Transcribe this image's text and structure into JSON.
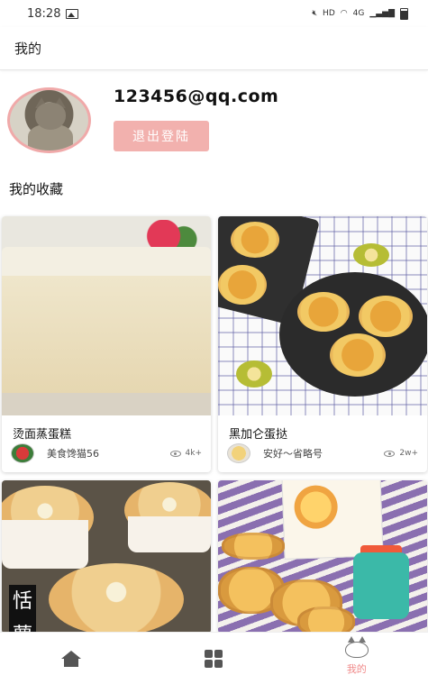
{
  "status_bar": {
    "time": "18:28",
    "network": "4G",
    "hd": "HD",
    "icons": [
      "image-icon",
      "mute-icon",
      "wifi-icon",
      "signal-icon",
      "battery-icon"
    ]
  },
  "app_bar": {
    "title": "我的"
  },
  "profile": {
    "email": "123456@qq.com",
    "logout_label": "退出登陆",
    "accent_color": "#f2b1ae"
  },
  "favorites": {
    "title": "我的收藏",
    "items": [
      {
        "title": "烫面蒸蛋糕",
        "author": "美食馋猫56",
        "views": "4k+"
      },
      {
        "title": "黑加仑蛋挞",
        "author": "安好～省略号",
        "views": "2w+"
      },
      {
        "title": "",
        "author": "",
        "views": ""
      },
      {
        "title": "",
        "author": "",
        "views": ""
      }
    ],
    "muffin_calligraphy": "恬蘿"
  },
  "tab_bar": {
    "tabs": [
      {
        "icon": "home-icon",
        "label": ""
      },
      {
        "icon": "grid-icon",
        "label": ""
      },
      {
        "icon": "cat-icon",
        "label": "我的",
        "active": true
      }
    ],
    "active_color": "#f08a8a"
  }
}
